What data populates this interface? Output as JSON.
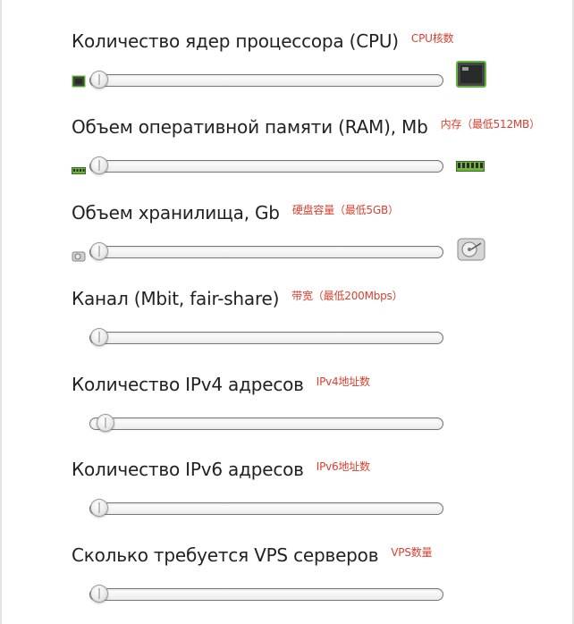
{
  "sections": [
    {
      "title": "Количество ядер процессора (CPU)",
      "note": "CPU核数",
      "left_icon": "small-cpu-chip-icon",
      "right_icon": "large-cpu-chip-icon",
      "slider_level": 0
    },
    {
      "title": "Объем оперативной памяти (RAM), Mb",
      "note": "内存（最低512MB）",
      "left_icon": "small-ram-module-icon",
      "right_icon": "large-ram-module-icon",
      "slider_level": 0
    },
    {
      "title": "Объем хранилища, Gb",
      "note": "硬盘容量（最低5GB）",
      "left_icon": "small-hard-disk-icon",
      "right_icon": "large-hard-disk-icon",
      "slider_level": 0
    },
    {
      "title": "Канал (Mbit, fair-share)",
      "note": "带宽（最低200Mbps）",
      "slider_level": 0
    },
    {
      "title": "Количество IPv4 адресов",
      "note": "IPv4地址数",
      "slider_level": 0.02
    },
    {
      "title": "Количество IPv6 адресов",
      "note": "IPv6地址数",
      "slider_level": 0
    },
    {
      "title": "Сколько требуется VPS серверов",
      "note": "VPS数量",
      "slider_level": 0
    }
  ]
}
